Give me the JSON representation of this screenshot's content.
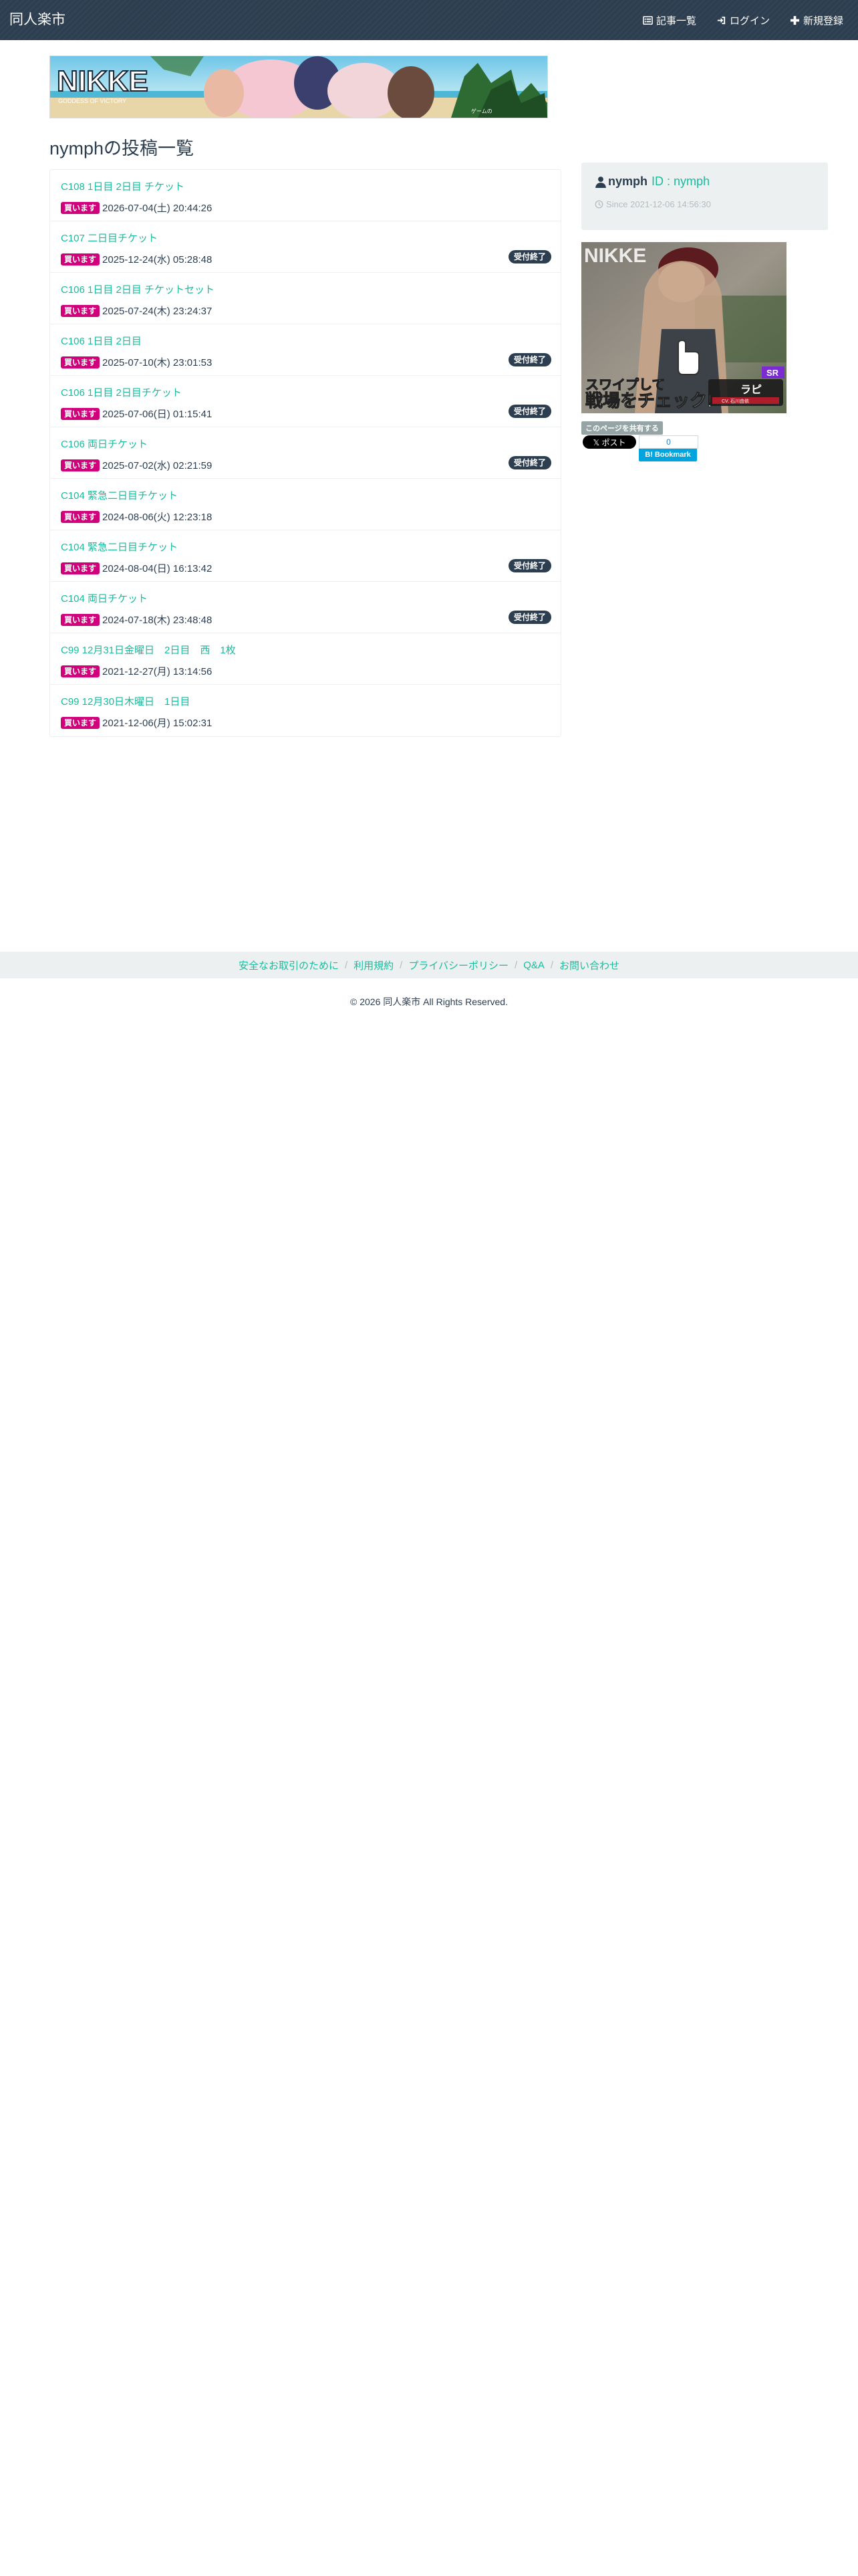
{
  "nav": {
    "brand": "同人楽市",
    "links": [
      {
        "label": "記事一覧",
        "icon": "list-icon"
      },
      {
        "label": "ログイン",
        "icon": "login-icon"
      },
      {
        "label": "新規登録",
        "icon": "plus-icon"
      }
    ]
  },
  "banner": {
    "logo_text": "NIKKE",
    "logo_sub": "GODDESS OF VICTORY",
    "caption": "ゲームの"
  },
  "page_title": "nymphの投稿一覧",
  "posts": [
    {
      "title": "C108 1日目 2日目 チケット",
      "badge": "買います",
      "date": "2026-07-04(土) 20:44:26",
      "status": ""
    },
    {
      "title": "C107 二日目チケット",
      "badge": "買います",
      "date": "2025-12-24(水) 05:28:48",
      "status": "受付終了"
    },
    {
      "title": "C106 1日目 2日目 チケットセット",
      "badge": "買います",
      "date": "2025-07-24(木) 23:24:37",
      "status": ""
    },
    {
      "title": "C106 1日目 2日目",
      "badge": "買います",
      "date": "2025-07-10(木) 23:01:53",
      "status": "受付終了"
    },
    {
      "title": "C106 1日目 2日目チケット",
      "badge": "買います",
      "date": "2025-07-06(日) 01:15:41",
      "status": "受付終了"
    },
    {
      "title": "C106 両日チケット",
      "badge": "買います",
      "date": "2025-07-02(水) 02:21:59",
      "status": "受付終了"
    },
    {
      "title": "C104 緊急二日目チケット",
      "badge": "買います",
      "date": "2024-08-06(火) 12:23:18",
      "status": ""
    },
    {
      "title": "C104 緊急二日目チケット",
      "badge": "買います",
      "date": "2024-08-04(日) 16:13:42",
      "status": "受付終了"
    },
    {
      "title": "C104 両日チケット",
      "badge": "買います",
      "date": "2024-07-18(木) 23:48:48",
      "status": "受付終了"
    },
    {
      "title": "C99 12月31日金曜日　2日目　西　1枚",
      "badge": "買います",
      "date": "2021-12-27(月) 13:14:56",
      "status": ""
    },
    {
      "title": "C99 12月30日木曜日　1日目",
      "badge": "買います",
      "date": "2021-12-06(月) 15:02:31",
      "status": ""
    }
  ],
  "profile": {
    "username": "nymph",
    "id_label": "ID : nymph",
    "since": "Since 2021-12-06 14:56:30"
  },
  "ad": {
    "line1": "スワイプして",
    "line2": "戦場をチェック!",
    "char_name": "ラピ",
    "char_sub": "CV. 石川由依",
    "tag": "SR"
  },
  "share": {
    "label": "このページを共有する",
    "x_post": "𝕏 ポスト",
    "bm_count": "0",
    "bm_label": "B! Bookmark"
  },
  "footer": {
    "links": [
      "安全なお取引のために",
      "利用規約",
      "プライバシーポリシー",
      "Q&A",
      "お問い合わせ"
    ],
    "copyright": "© 2026 同人楽市 All Rights Reserved."
  }
}
